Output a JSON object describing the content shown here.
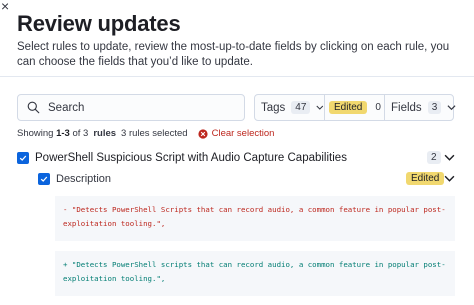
{
  "modal": {
    "title": "Review updates",
    "subtitle": "Select rules to update, review the most-up-to-date fields by clicking on each rule, you can choose the fields that you’d like to update."
  },
  "search": {
    "placeholder": "Search"
  },
  "filters": {
    "tags": {
      "label": "Tags",
      "count": "47"
    },
    "edited": {
      "label": "Edited",
      "count": "0"
    },
    "fields": {
      "label": "Fields",
      "count": "3"
    }
  },
  "status": {
    "showing": "Showing",
    "range": "1-3",
    "of_text": "of 3",
    "rules": "rules",
    "selected": "3 rules selected",
    "clear": "Clear selection"
  },
  "rule": {
    "name": "PowerShell Suspicious Script with Audio Capture Capabilities",
    "count": "2"
  },
  "field": {
    "name": "Description",
    "badge": "Edited"
  },
  "diff": {
    "old_lines": [
      "- \"Detects PowerShell Scripts that can record audio, a common feature in popular post-",
      "exploitation tooling.\","
    ],
    "new_lines": [
      "+ \"Detects PowerShell scripts that can record audio, a common feature in popular post-",
      "exploitation tooling.\","
    ]
  },
  "colors": {
    "accent": "#0b64dd",
    "danger": "#bd271e",
    "success": "#017d73",
    "edited_badge": "#f1d86f"
  }
}
